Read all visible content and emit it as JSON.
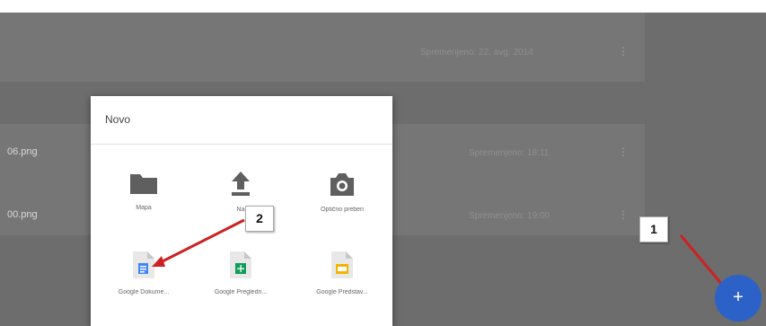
{
  "rows": [
    {
      "name": "",
      "modified": "Spremenjeno: 22. avg. 2014"
    },
    {
      "name": "06.png",
      "modified": "Spremenjeno: 18:11"
    },
    {
      "name": "00.png",
      "modified": "Spremenjeno: 19:00"
    }
  ],
  "dialog": {
    "title": "Novo",
    "options": [
      {
        "label": "Mapa",
        "icon": "folder-icon"
      },
      {
        "label": "Na",
        "icon": "upload-icon"
      },
      {
        "label": "Optično preberi",
        "icon": "camera-icon"
      },
      {
        "label": "Google Dokume...",
        "icon": "google-docs-icon"
      },
      {
        "label": "Google Pregledn...",
        "icon": "google-sheets-icon"
      },
      {
        "label": "Google Predstav...",
        "icon": "google-slides-icon"
      }
    ]
  },
  "callouts": {
    "first": "1",
    "second": "2"
  },
  "fab": {
    "symbol": "+"
  },
  "colors": {
    "arrow": "#cc2222",
    "fab": "#2c62c7",
    "docs": "#4285f4",
    "sheets": "#0f9d58",
    "slides": "#f4b400"
  }
}
